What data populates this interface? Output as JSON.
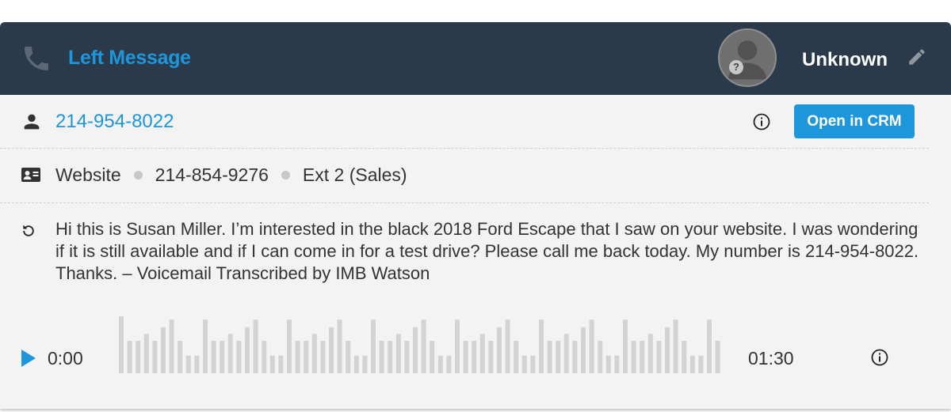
{
  "header": {
    "title": "Left Message",
    "contact_name": "Unknown",
    "avatar_badge": "?"
  },
  "caller": {
    "phone": "214-954-8022",
    "crm_button_label": "Open in CRM"
  },
  "source": {
    "items": [
      "Website",
      "214-854-9276",
      "Ext 2 (Sales)"
    ]
  },
  "transcript": {
    "text": "Hi this is Susan Miller. I’m interested in the black 2018 Ford Escape that I saw on your website. I was wondering if it is still available and if I can come in for a test drive? Please call me back today. My number is 214-954-8022. Thanks.  – Voicemail Transcribed by IMB Watson"
  },
  "player": {
    "current_time": "0:00",
    "duration": "01:30",
    "waveform_levels": [
      1.0,
      0.57,
      0.57,
      0.69,
      0.57,
      0.81,
      0.94,
      0.57,
      0.31,
      0.31,
      0.94,
      0.57,
      0.57,
      0.69,
      0.57,
      0.81,
      0.94,
      0.57,
      0.31,
      0.31,
      0.94,
      0.57,
      0.57,
      0.69,
      0.57,
      0.81,
      0.94,
      0.57,
      0.31,
      0.31,
      0.94,
      0.57,
      0.57,
      0.69,
      0.57,
      0.81,
      0.94,
      0.57,
      0.31,
      0.31,
      0.94,
      0.57,
      0.57,
      0.69,
      0.57,
      0.81,
      0.94,
      0.57,
      0.31,
      0.31,
      0.94,
      0.57,
      0.57,
      0.69,
      0.57,
      0.81,
      0.94,
      0.57,
      0.31,
      0.31,
      0.94,
      0.57,
      0.57,
      0.69,
      0.57,
      0.81,
      0.94,
      0.57,
      0.31,
      0.31,
      0.94,
      0.57
    ]
  },
  "colors": {
    "header_bg": "#2a3a4a",
    "accent": "#1e96dc",
    "card_bg": "#f3f3f3",
    "waveform": "#d3d3d3"
  },
  "icons": {
    "header": "phone-icon",
    "edit": "pencil-icon",
    "caller": "person-icon",
    "source": "contact-card-icon",
    "transcript": "sync-icon",
    "info": "info-icon",
    "play": "play-icon"
  }
}
